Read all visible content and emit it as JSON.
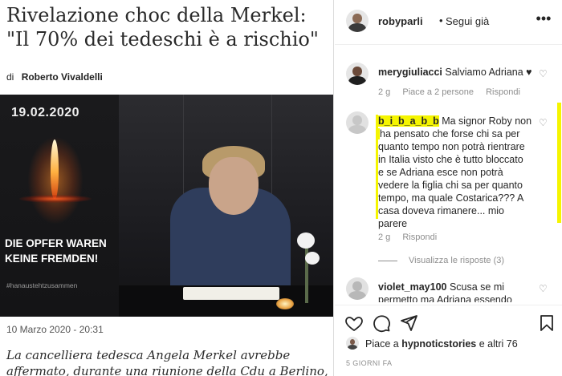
{
  "article": {
    "headline_line1": "Rivelazione choc della Merkel:",
    "headline_line2": "\"Il 70% dei tedeschi è a rischio\"",
    "byline_prefix": "di",
    "author": "Roberto Vivaldelli",
    "date": "10 Marzo 2020 - 20:31",
    "lead_line1": "La cancelliera tedesca Angela Merkel avrebbe",
    "lead_line2": "affermato, durante una riunione della Cdu a Berlino,",
    "photo": {
      "banner_date": "19.02.2020",
      "banner_text_line1": "DIE OPFER WAREN",
      "banner_text_line2": "KEINE FREMDEN!",
      "banner_hashtag": "#hanaustehtzusammen"
    }
  },
  "instagram": {
    "header": {
      "username": "robyparli",
      "dot": "•",
      "follow_label": "Segui già",
      "more_icon": "more-horizontal-icon"
    },
    "comments": [
      {
        "user": "merygiuliacci",
        "text": "Salviamo Adriana ♥",
        "meta": [
          "2 g",
          "Piace a 2 persone",
          "Rispondi"
        ]
      },
      {
        "user": "b_i_b_a_b_b",
        "text_lines": [
          "Ma signor Roby non",
          "ha pensato che forse chi sa per",
          "quanto tempo non potrà rientrare",
          "in Italia visto che è tutto bloccato",
          "e se Adriana esce non potrà",
          "vedere la figlia chi sa per quanto",
          "tempo, ma quale Costarica??? A",
          "casa doveva rimanere... mio",
          "parere"
        ],
        "meta": [
          "2 g",
          "Rispondi"
        ],
        "replies_label": "Visualizza le risposte (3)"
      },
      {
        "user": "violet_may100",
        "text_lines": [
          "Scusa se mi",
          "permetto ma Adriana essendo"
        ]
      }
    ],
    "likes": {
      "prefix": "Piace a",
      "user": "hypnoticstories",
      "suffix": "e altri 76"
    },
    "time_ago": "5 GIORNI FA",
    "highlight_color": "#f5f500"
  }
}
